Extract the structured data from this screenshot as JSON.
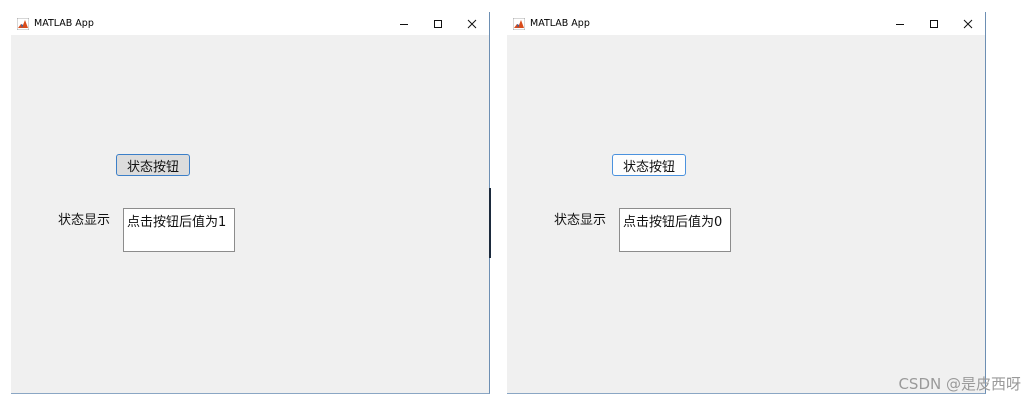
{
  "windows": [
    {
      "title": "MATLAB App",
      "controls": {
        "minimize": "—",
        "maximize": "☐",
        "close": "✕"
      },
      "button_label": "状态按钮",
      "button_state": "pressed",
      "field_label": "状态显示",
      "field_value": "点击按钮后值为1"
    },
    {
      "title": "MATLAB App",
      "controls": {
        "minimize": "—",
        "maximize": "☐",
        "close": "✕"
      },
      "button_label": "状态按钮",
      "button_state": "released",
      "field_label": "状态显示",
      "field_value": "点击按钮后值为0"
    }
  ],
  "watermark": "CSDN @是皮西呀",
  "colors": {
    "window_bg": "#f0f0f0",
    "titlebar_bg": "#ffffff",
    "accent": "#2b7bd6",
    "matlab_icon": "#d94b1a"
  }
}
